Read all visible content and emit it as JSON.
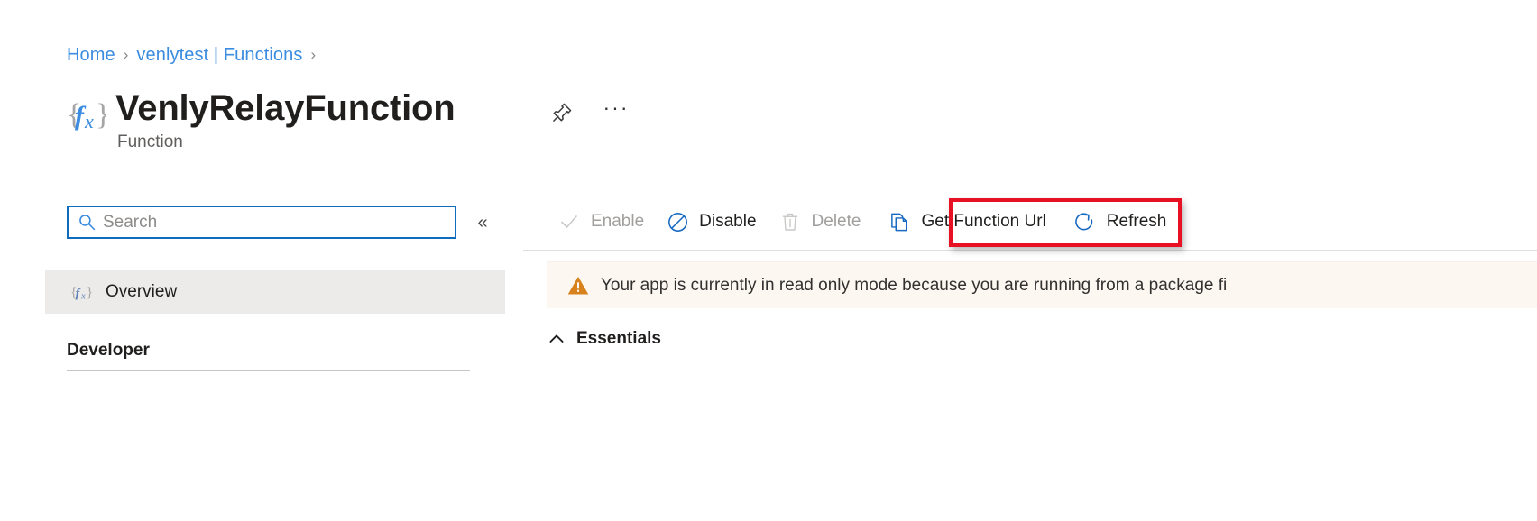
{
  "breadcrumb": {
    "name": "breadcrumb",
    "items": [
      {
        "label": "Home",
        "separator": "›"
      },
      {
        "label": "venlytest | Functions",
        "separator": "›"
      }
    ],
    "separator": "›"
  },
  "header": {
    "icon": "function-fx-icon",
    "title": "VenlyRelayFunction",
    "subtitle": "Function",
    "pin_icon": "pin-icon",
    "more_icon": "ellipsis-icon",
    "more_label": "···"
  },
  "sidebar": {
    "search": {
      "icon": "search-icon",
      "placeholder": "Search",
      "value": ""
    },
    "collapse": {
      "icon": "double-chevron-left-icon",
      "label": "«"
    },
    "items": [
      {
        "label": "Overview",
        "icon": "function-fx-icon",
        "selected": true
      }
    ],
    "sections": [
      {
        "label": "Developer"
      }
    ]
  },
  "toolbar": {
    "commands": [
      {
        "label": "Enable",
        "icon": "checkmark-icon",
        "disabled": true
      },
      {
        "label": "Disable",
        "icon": "block-circle-icon",
        "disabled": false
      },
      {
        "label": "Delete",
        "icon": "trash-icon",
        "disabled": true
      },
      {
        "label": "Get Function Url",
        "icon": "copy-pages-icon",
        "disabled": false,
        "highlighted": true
      },
      {
        "label": "Refresh",
        "icon": "refresh-circle-icon",
        "disabled": false
      }
    ],
    "highlight_color": "#e81123"
  },
  "banner": {
    "icon": "warning-triangle-icon",
    "text": "Your app is currently in read only mode because you are running from a package fi",
    "background": "#fdf7f1",
    "icon_color": "#d8821e"
  },
  "essentials": {
    "icon": "chevron-up-icon",
    "label": "Essentials"
  },
  "colors": {
    "link": "#3b8ce0",
    "accent": "#0f6cbd",
    "selected_row": "#edebe9",
    "disabled_text": "#a19f9d"
  }
}
